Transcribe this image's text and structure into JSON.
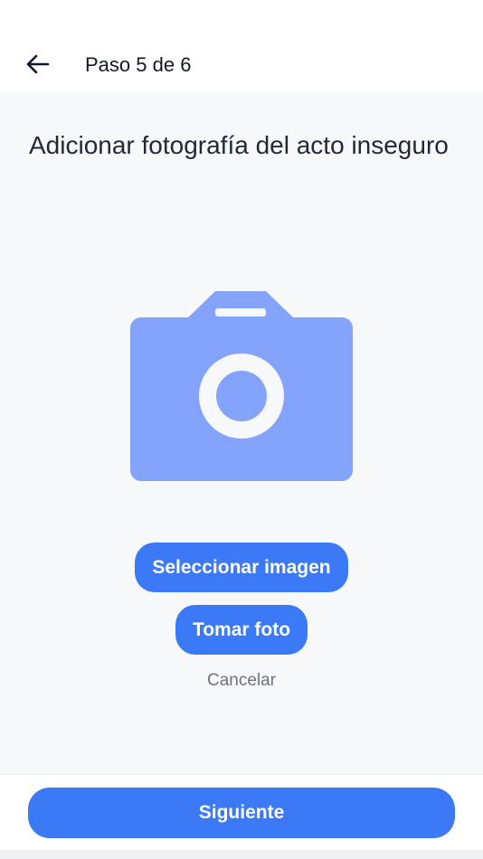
{
  "header": {
    "step_label": "Paso 5 de 6",
    "back_icon": "arrow-left-icon"
  },
  "main": {
    "title": "Adicionar fotografía  del acto inseguro",
    "placeholder_icon": "camera-icon",
    "select_image_label": "Seleccionar imagen",
    "take_photo_label": "Tomar foto",
    "cancel_label": "Cancelar"
  },
  "footer": {
    "next_label": "Siguiente"
  },
  "colors": {
    "primary": "#3b79f6",
    "camera_fill": "#84a4fb",
    "background": "#f7f8fa",
    "header_bg": "#ffffff",
    "title_text": "#1f2937",
    "muted_text": "#6b7280"
  }
}
